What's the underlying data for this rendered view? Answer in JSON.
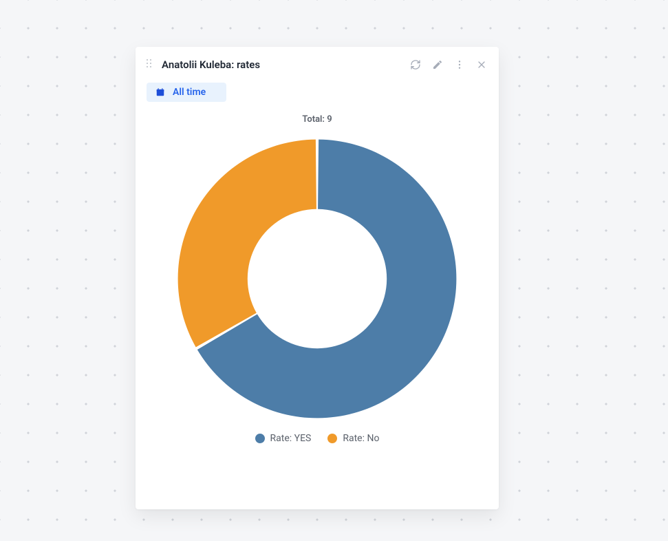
{
  "card": {
    "title": "Anatolii Kuleba: rates",
    "filter_label": "All time",
    "colors": {
      "yes": "#4d7da8",
      "no": "#f09a2a"
    }
  },
  "chart_data": {
    "type": "pie",
    "title": "Total: 9",
    "total": 9,
    "series": [
      {
        "name": "Rate: YES",
        "value": 6,
        "color": "#4d7da8"
      },
      {
        "name": "Rate: No",
        "value": 3,
        "color": "#f09a2a"
      }
    ]
  }
}
